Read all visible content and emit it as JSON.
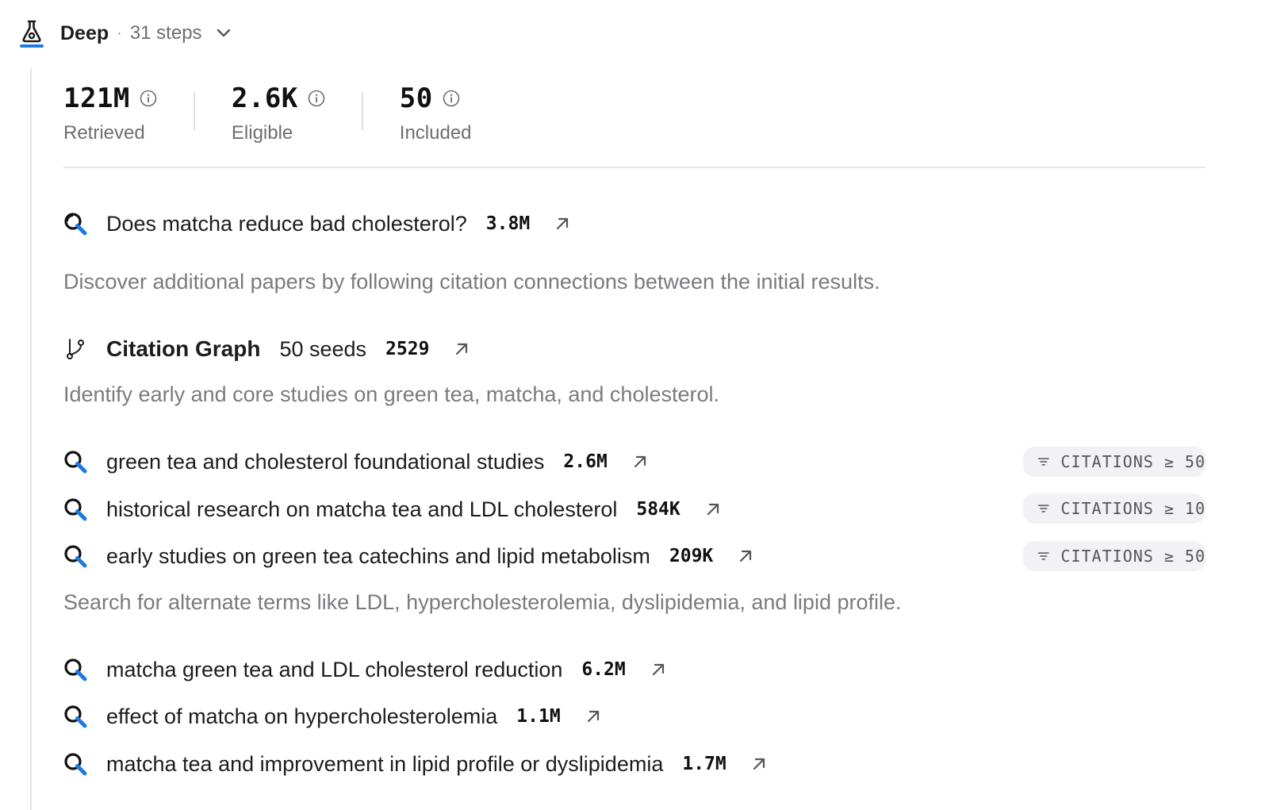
{
  "header": {
    "mode_name": "Deep",
    "separator": "·",
    "steps": "31 steps"
  },
  "stats": [
    {
      "value": "121M",
      "label": "Retrieved"
    },
    {
      "value": "2.6K",
      "label": "Eligible"
    },
    {
      "value": "50",
      "label": "Included"
    }
  ],
  "main_query": {
    "text": "Does matcha reduce bad cholesterol?",
    "count": "3.8M"
  },
  "desc1": "Discover additional papers by following citation connections between the initial results.",
  "citation_graph": {
    "title": "Citation Graph",
    "seeds": "50 seeds",
    "count": "2529"
  },
  "desc2": "Identify early and core studies on green tea, matcha, and cholesterol.",
  "filtered_queries": [
    {
      "text": "green tea and cholesterol foundational studies",
      "count": "2.6M",
      "badge": "CITATIONS ≥ 50"
    },
    {
      "text": "historical research on matcha tea and LDL cholesterol",
      "count": "584K",
      "badge": "CITATIONS ≥ 10"
    },
    {
      "text": "early studies on green tea catechins and lipid metabolism",
      "count": "209K",
      "badge": "CITATIONS ≥ 50"
    }
  ],
  "desc3": "Search for alternate terms like LDL, hypercholesterolemia, dyslipidemia, and lipid profile.",
  "alt_queries": [
    {
      "text": "matcha green tea and LDL cholesterol reduction",
      "count": "6.2M"
    },
    {
      "text": "effect of matcha on hypercholesterolemia",
      "count": "1.1M"
    },
    {
      "text": "matcha tea and improvement in lipid profile or dyslipidemia",
      "count": "1.7M"
    }
  ],
  "colors": {
    "accent": "#1f7ae0",
    "text": "#1d1d1f",
    "muted": "#7a7a80",
    "badge_bg": "#f2f2f4"
  },
  "icons": {
    "mode": "flask-icon",
    "query": "search-icon",
    "graph": "branch-icon",
    "open": "arrow-up-right-icon",
    "info": "info-icon",
    "filter": "filter-icon",
    "expand": "chevron-down-icon"
  }
}
